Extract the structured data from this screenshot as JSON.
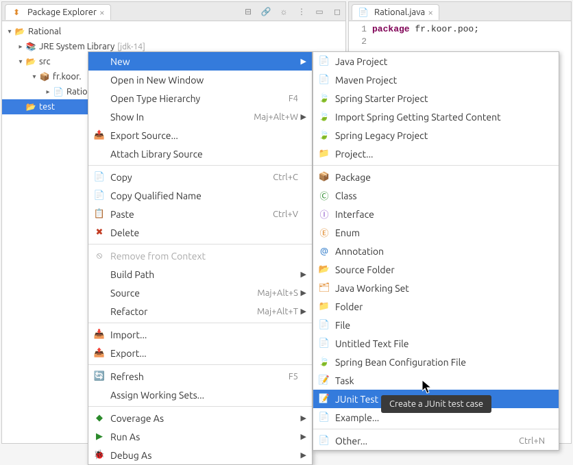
{
  "explorer": {
    "title": "Package Explorer",
    "project": "Rational",
    "jre_label": "JRE System Library",
    "jre_suffix": "[jdk-14]",
    "src_label": "src",
    "package_label": "fr.koor.",
    "class_label": "Ratio",
    "test_label": "test"
  },
  "editor": {
    "tab_title": "Rational.java",
    "line1_kw": "package",
    "line1_rest": " fr.koor.poo;"
  },
  "context_menu": [
    {
      "label": "New",
      "arrow": true,
      "highlight": true
    },
    {
      "label": "Open in New Window"
    },
    {
      "label": "Open Type Hierarchy",
      "accel": "F4"
    },
    {
      "label": "Show In",
      "accel": "Maj+Alt+W",
      "arrow": true
    },
    {
      "label": "Export Source...",
      "icon": "📤",
      "iconClass": "ic-teal"
    },
    {
      "label": "Attach Library Source"
    },
    {
      "sep": true
    },
    {
      "label": "Copy",
      "accel": "Ctrl+C",
      "icon": "📄",
      "iconClass": "ic-gray"
    },
    {
      "label": "Copy Qualified Name",
      "icon": "📄",
      "iconClass": "ic-gray"
    },
    {
      "label": "Paste",
      "accel": "Ctrl+V",
      "icon": "📋",
      "iconClass": "ic-gray"
    },
    {
      "label": "Delete",
      "icon": "✖",
      "iconClass": "ic-red"
    },
    {
      "sep": true
    },
    {
      "label": "Remove from Context",
      "disabled": true,
      "icon": "⦸",
      "iconClass": "ic-gray"
    },
    {
      "label": "Build Path",
      "arrow": true
    },
    {
      "label": "Source",
      "accel": "Maj+Alt+S",
      "arrow": true
    },
    {
      "label": "Refactor",
      "accel": "Maj+Alt+T",
      "arrow": true
    },
    {
      "sep": true
    },
    {
      "label": "Import...",
      "icon": "📥",
      "iconClass": "ic-teal"
    },
    {
      "label": "Export...",
      "icon": "📤",
      "iconClass": "ic-teal"
    },
    {
      "sep": true
    },
    {
      "label": "Refresh",
      "accel": "F5",
      "icon": "🔄",
      "iconClass": "ic-orange"
    },
    {
      "label": "Assign Working Sets..."
    },
    {
      "sep": true
    },
    {
      "label": "Coverage As",
      "arrow": true,
      "icon": "◆",
      "iconClass": "ic-green"
    },
    {
      "label": "Run As",
      "arrow": true,
      "icon": "▶",
      "iconClass": "ic-green"
    },
    {
      "label": "Debug As",
      "arrow": true,
      "icon": "🐞",
      "iconClass": "ic-teal"
    }
  ],
  "submenu": [
    {
      "label": "Java Project",
      "icon": "📄",
      "iconClass": "ic-blue"
    },
    {
      "label": "Maven Project",
      "icon": "📄",
      "iconClass": "ic-orange"
    },
    {
      "label": "Spring Starter Project",
      "icon": "🍃",
      "iconClass": "ic-green"
    },
    {
      "label": "Import Spring Getting Started Content",
      "icon": "🍃",
      "iconClass": "ic-green"
    },
    {
      "label": "Spring Legacy Project",
      "icon": "🍃",
      "iconClass": "ic-green"
    },
    {
      "label": "Project...",
      "icon": "📁",
      "iconClass": "ic-gray"
    },
    {
      "sep": true
    },
    {
      "label": "Package",
      "icon": "📦",
      "iconClass": "ic-orange"
    },
    {
      "label": "Class",
      "icon": "Ⓒ",
      "iconClass": "ic-green"
    },
    {
      "label": "Interface",
      "icon": "Ⓘ",
      "iconClass": "ic-purple"
    },
    {
      "label": "Enum",
      "icon": "Ⓔ",
      "iconClass": "ic-orange"
    },
    {
      "label": "Annotation",
      "icon": "@",
      "iconClass": "ic-blue"
    },
    {
      "label": "Source Folder",
      "icon": "📂",
      "iconClass": "ic-orange"
    },
    {
      "label": "Java Working Set",
      "icon": "🗂",
      "iconClass": "ic-orange"
    },
    {
      "label": "Folder",
      "icon": "📁",
      "iconClass": "ic-folder"
    },
    {
      "label": "File",
      "icon": "📄",
      "iconClass": "ic-gray"
    },
    {
      "label": "Untitled Text File",
      "icon": "📄",
      "iconClass": "ic-gray"
    },
    {
      "label": "Spring Bean Configuration File",
      "icon": "🍃",
      "iconClass": "ic-green"
    },
    {
      "label": "Task",
      "icon": "📝",
      "iconClass": "ic-blue"
    },
    {
      "label": "JUnit Test Case",
      "icon": "📝",
      "iconClass": "ic-green",
      "highlight": true
    },
    {
      "label": "Example...",
      "icon": "📄",
      "iconClass": "ic-folder"
    },
    {
      "sep": true
    },
    {
      "label": "Other...",
      "accel": "Ctrl+N",
      "icon": "📄",
      "iconClass": "ic-gray"
    }
  ],
  "tooltip": "Create a JUnit test case"
}
